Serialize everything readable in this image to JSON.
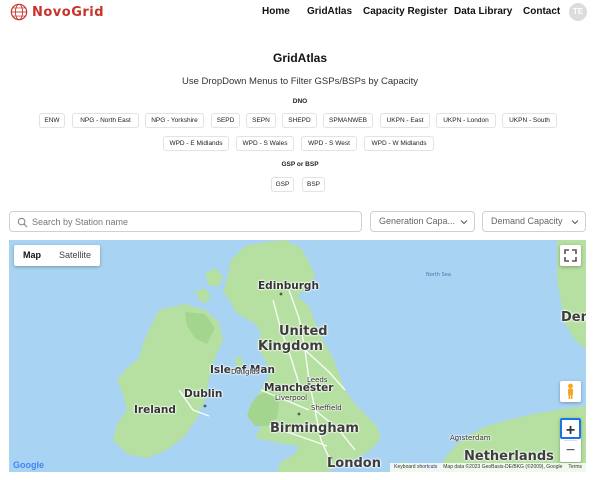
{
  "brand": {
    "name_part1": "Novo",
    "name_part2": "Grid"
  },
  "nav": {
    "items": [
      "Home",
      "GridAtlas",
      "Capacity Register",
      "Data Library",
      "Contact"
    ],
    "avatar_initials": "TE"
  },
  "page": {
    "title": "GridAtlas",
    "subtitle": "Use DropDown Menus to Filter GSPs/BSPs by Capacity"
  },
  "dno": {
    "label": "DNO",
    "row1": [
      "ENW",
      "NPG - North East",
      "NPG - Yorkshire",
      "SEPD",
      "SEPN",
      "SHEPD",
      "SPMANWEB",
      "UKPN - East",
      "UKPN - London",
      "UKPN - South"
    ],
    "row2": [
      "WPD - E Midlands",
      "WPD - S Wales",
      "WPD - S West",
      "WPD - W Midlands"
    ]
  },
  "gsp_bsp": {
    "label": "GSP or BSP",
    "options": [
      "GSP",
      "BSP"
    ]
  },
  "filters": {
    "search_placeholder": "Search by Station name",
    "generation_label": "Generation Capa...",
    "demand_label": "Demand Capacity"
  },
  "map": {
    "type_map": "Map",
    "type_satellite": "Satellite",
    "labels": {
      "north_sea": "North Sea",
      "edinburgh": "Edinburgh",
      "united_kingdom_1": "United",
      "united_kingdom_2": "Kingdom",
      "isle_of_man": "Isle of Man",
      "douglas": "Douglas",
      "manchester": "Manchester",
      "leeds": "Leeds",
      "sheffield": "Sheffield",
      "liverpool": "Liverpool",
      "dublin": "Dublin",
      "ireland": "Ireland",
      "birmingham": "Birmingham",
      "london": "London",
      "amsterdam": "Amsterdam",
      "netherlands": "Netherlands",
      "denmark_partial": "Den"
    },
    "google": "Google",
    "attribution": {
      "shortcuts": "Keyboard shortcuts",
      "data": "Map data ©2023 GeoBasis-DE/BKG (©2009), Google",
      "terms": "Terms"
    },
    "zoom_in": "+",
    "zoom_out": "−",
    "colors": {
      "sea": "#a9d3f2",
      "land": "#b6dfa2",
      "land_dark": "#a4d58f",
      "roads": "#ffffff"
    }
  }
}
